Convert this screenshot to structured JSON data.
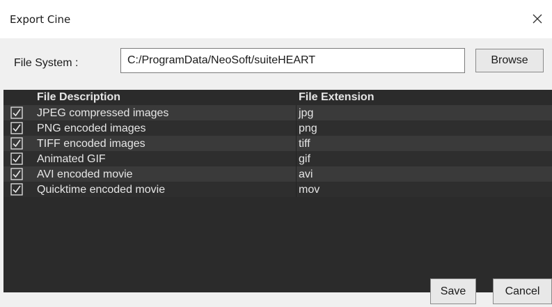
{
  "window": {
    "title": "Export Cine",
    "close_icon": "close-icon"
  },
  "file_system": {
    "label": "File System  :",
    "value": "C:/ProgramData/NeoSoft/suiteHEART",
    "browse_label": "Browse"
  },
  "table": {
    "headers": {
      "description": "File Description",
      "extension": "File Extension"
    },
    "rows": [
      {
        "checked": true,
        "description": "JPEG compressed images",
        "extension": "jpg"
      },
      {
        "checked": true,
        "description": "PNG encoded images",
        "extension": "png"
      },
      {
        "checked": true,
        "description": "TIFF encoded images",
        "extension": "tiff"
      },
      {
        "checked": true,
        "description": "Animated GIF",
        "extension": "gif"
      },
      {
        "checked": true,
        "description": "AVI encoded movie",
        "extension": "avi"
      },
      {
        "checked": true,
        "description": "Quicktime encoded movie",
        "extension": "mov"
      }
    ]
  },
  "buttons": {
    "save_label": "Save",
    "cancel_label": "Cancel"
  },
  "colors": {
    "table_background": "#2b2b2b",
    "row_alt": "#3a3a3a",
    "dialog_background": "#f0f0f0",
    "text_light": "#e6e6e6"
  }
}
